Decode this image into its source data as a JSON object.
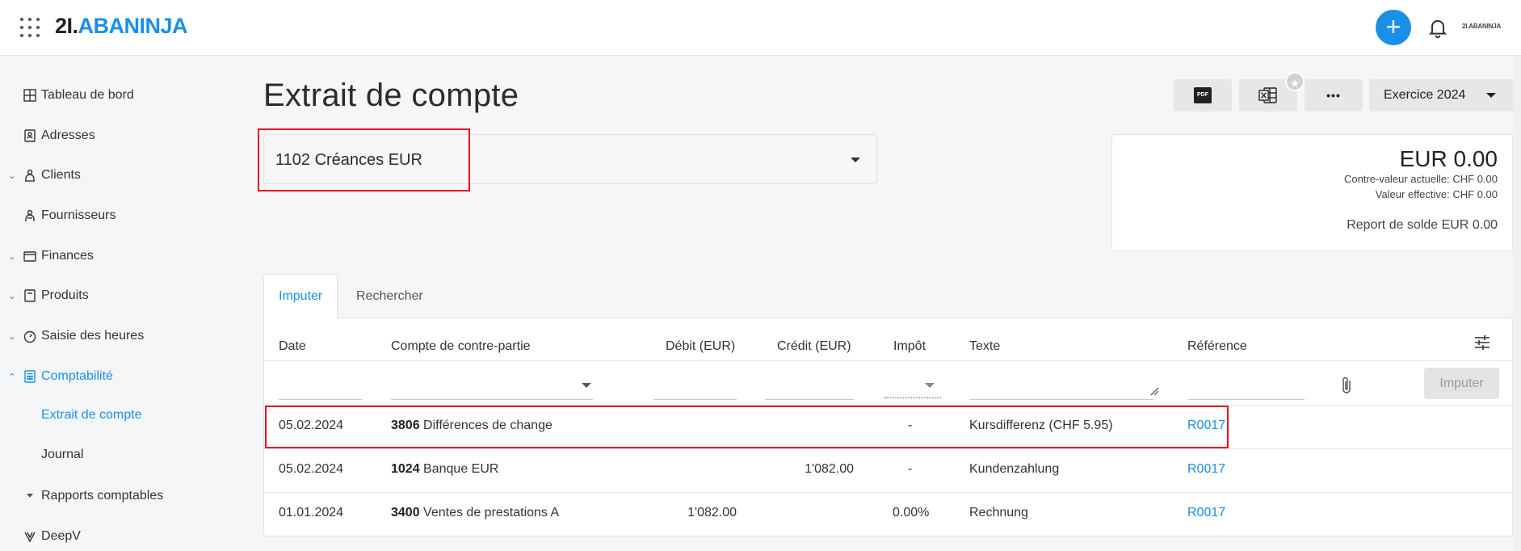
{
  "topbar": {
    "logo_part1": "2I.",
    "logo_part2": "ABANINJA",
    "mini_logo": "2I.ABANINJA",
    "add_label": "+"
  },
  "sidebar": {
    "items": [
      {
        "label": "Tableau de bord",
        "icon": "dashboard-icon",
        "chevron": ""
      },
      {
        "label": "Adresses",
        "icon": "address-book-icon",
        "chevron": ""
      },
      {
        "label": "Clients",
        "icon": "clients-icon",
        "chevron": "⌄"
      },
      {
        "label": "Fournisseurs",
        "icon": "suppliers-icon",
        "chevron": ""
      },
      {
        "label": "Finances",
        "icon": "wallet-icon",
        "chevron": "⌄"
      },
      {
        "label": "Produits",
        "icon": "product-icon",
        "chevron": "⌄"
      },
      {
        "label": "Saisie des heures",
        "icon": "stopwatch-icon",
        "chevron": "⌄"
      },
      {
        "label": "Comptabilité",
        "icon": "calculator-icon",
        "chevron": "⌃"
      }
    ],
    "sub_items": [
      {
        "label": "Extrait de compte"
      },
      {
        "label": "Journal"
      },
      {
        "label": "Rapports comptables"
      },
      {
        "label": "DeepV"
      }
    ]
  },
  "main": {
    "title": "Extrait de compte",
    "toolbar": {
      "pdf_label": "PDF",
      "more_label": "•••",
      "exercise_label": "Exercice 2024",
      "fav_label": "★"
    },
    "account_select_value": "1102 Créances EUR",
    "balance": {
      "amount": "EUR 0.00",
      "contre_valeur": "Contre-valeur actuelle: CHF 0.00",
      "valeur_effective": "Valeur effective: CHF 0.00",
      "report": "Report de solde EUR 0.00"
    },
    "tabs": [
      {
        "label": "Imputer"
      },
      {
        "label": "Rechercher"
      }
    ],
    "table": {
      "headers": [
        "Date",
        "Compte de contre-partie",
        "Débit (EUR)",
        "Crédit (EUR)",
        "Impôt",
        "Texte",
        "Référence"
      ],
      "imputer_button": "Imputer",
      "rows": [
        {
          "date": "05.02.2024",
          "account_no": "3806",
          "account_name": "Différences de change",
          "debit": "",
          "credit": "",
          "tax": "-",
          "text": "Kursdifferenz (CHF 5.95)",
          "ref": "R0017"
        },
        {
          "date": "05.02.2024",
          "account_no": "1024",
          "account_name": "Banque EUR",
          "debit": "",
          "credit": "1'082.00",
          "tax": "-",
          "text": "Kundenzahlung",
          "ref": "R0017"
        },
        {
          "date": "01.01.2024",
          "account_no": "3400",
          "account_name": "Ventes de prestations A",
          "debit": "1'082.00",
          "credit": "",
          "tax": "0.00%",
          "text": "Rechnung",
          "ref": "R0017"
        }
      ]
    }
  },
  "colors": {
    "accent": "#1a8fe8",
    "highlight": "#e5101e"
  }
}
